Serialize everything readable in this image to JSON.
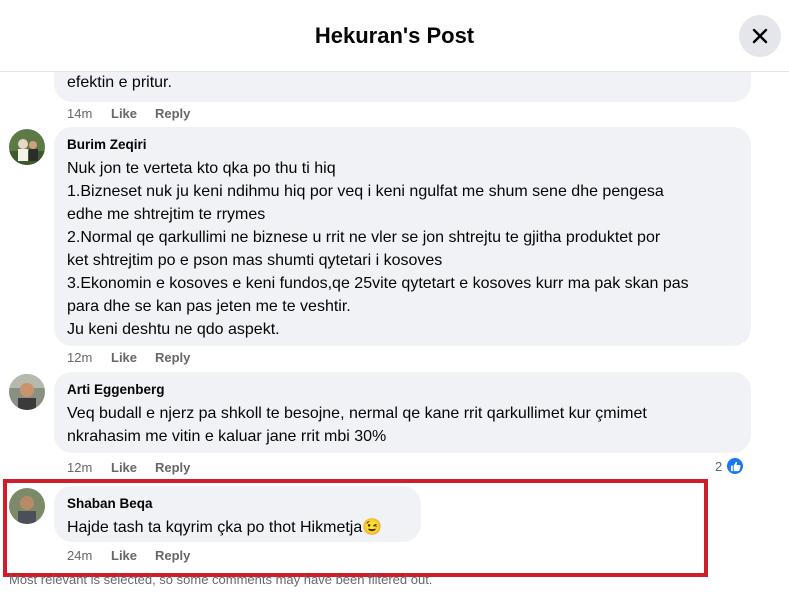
{
  "header": {
    "title": "Hekuran's Post"
  },
  "comments": [
    {
      "text_tail": "efektin e pritur.",
      "time": "14m",
      "like": "Like",
      "reply": "Reply"
    },
    {
      "author": "Burim Zeqiri",
      "lines": [
        "Nuk jon te verteta kto qka po thu ti hiq",
        "1.Bizneset nuk ju keni ndihmu hiq por veq i keni ngulfat me shum sene dhe pengesa",
        "edhe me shtrejtim te rrymes",
        "2.Normal qe qarkullimi ne biznese u rrit ne vler se jon shtrejtu te gjitha produktet por",
        "ket shtrejtim po e pson mas shumti qytetari i kosoves",
        "3.Ekonomin e kosoves e keni fundos,qe 25vite qytetart e kosoves kurr ma pak skan pas",
        "para dhe se kan pas jeten me te veshtir.",
        "Ju keni deshtu ne qdo aspekt."
      ],
      "time": "12m",
      "like": "Like",
      "reply": "Reply"
    },
    {
      "author": "Arti Eggenberg",
      "lines": [
        "Veq budall e njerz pa shkoll te besojne, nermal qe kane rrit qarkullimet kur çmimet",
        "nkrahasim me vitin e kaluar jane rrit mbi 30%"
      ],
      "time": "12m",
      "like": "Like",
      "reply": "Reply",
      "reaction_count": "2"
    },
    {
      "author": "Shaban Beqa",
      "text": "Hajde tash ta kqyrim çka po thot Hikmetja",
      "emoji": "😉",
      "time": "24m",
      "like": "Like",
      "reply": "Reply"
    }
  ],
  "footer_note": "Most relevant is selected, so some comments may have been filtered out.",
  "colors": {
    "highlight": "#d01d2a",
    "bubble": "#f0f2f5",
    "like_blue": "#1877f2"
  }
}
